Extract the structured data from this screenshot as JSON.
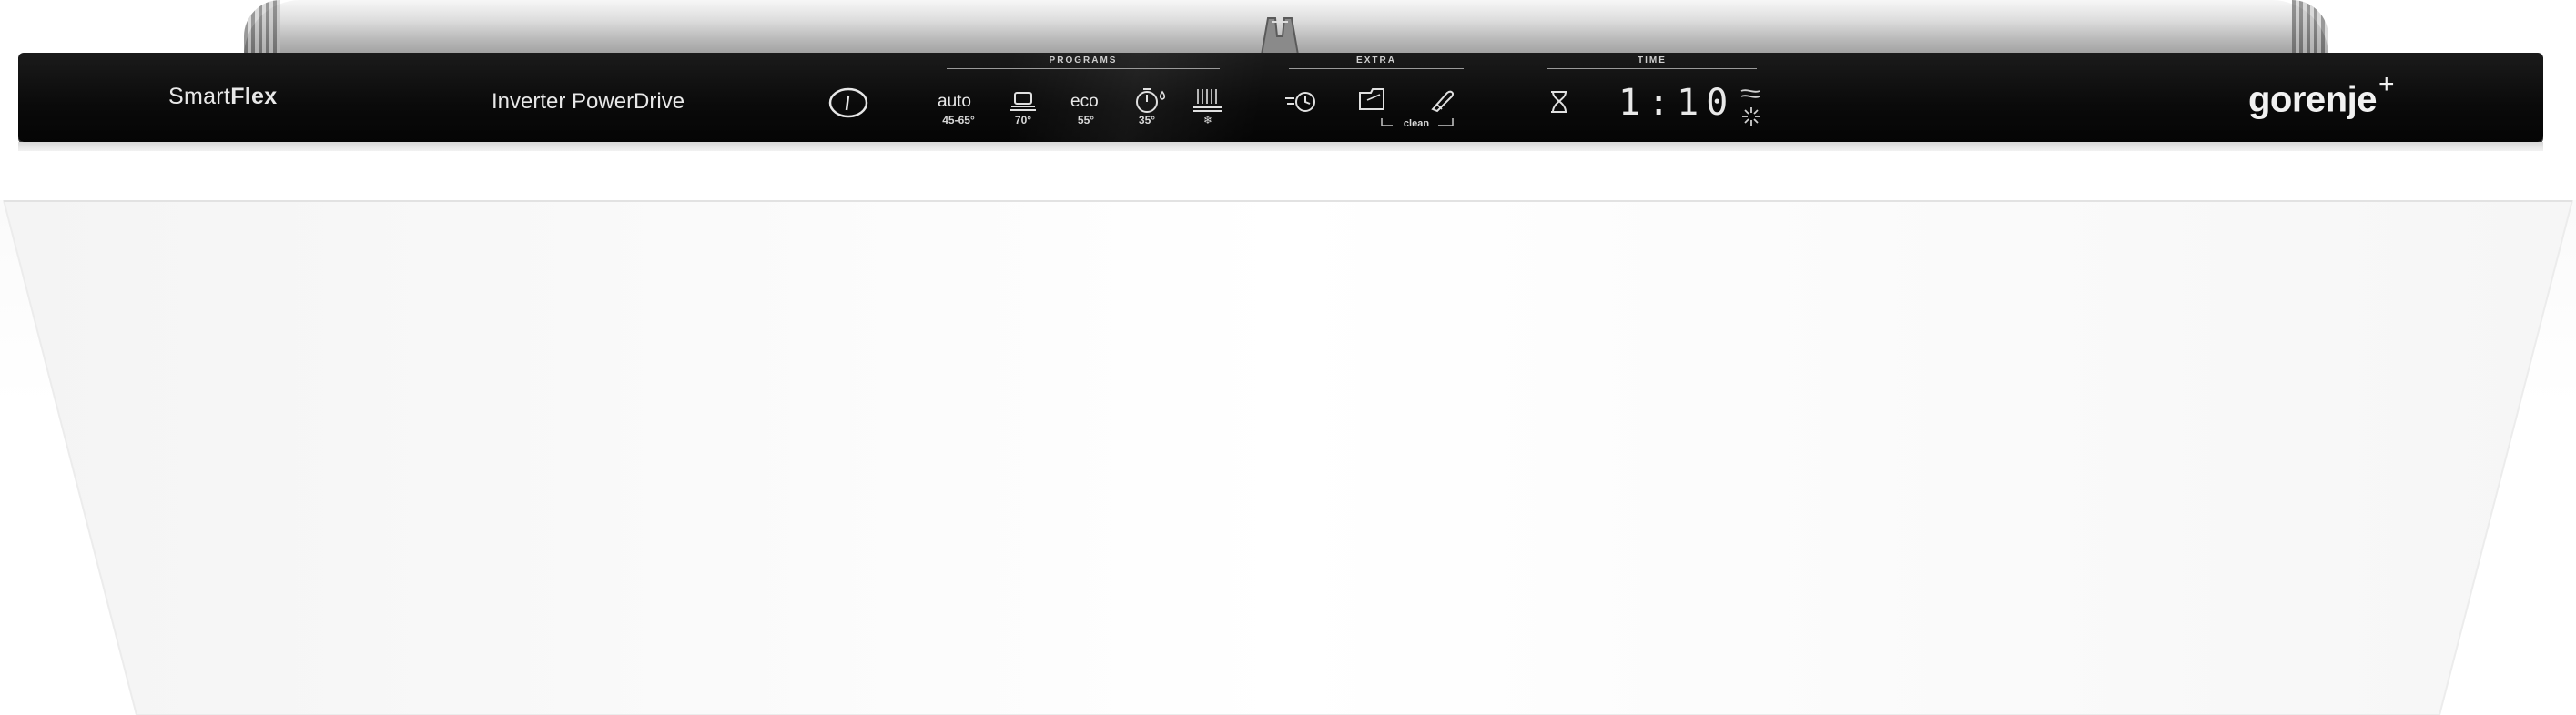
{
  "brand": {
    "series_prefix": "Smart",
    "series_suffix": "Flex",
    "technology": "Inverter PowerDrive",
    "logo": "gorenje",
    "logo_mark": "+"
  },
  "sections": {
    "programs": "PROGRAMS",
    "extra": "EXTRA",
    "time": "TIME"
  },
  "programs": [
    {
      "id": "auto",
      "icon": "auto-text",
      "top": "auto",
      "label": "45-65°"
    },
    {
      "id": "intensive",
      "icon": "pot-icon",
      "label": "70°"
    },
    {
      "id": "eco",
      "icon": "eco-text",
      "top": "eco",
      "label": "55°"
    },
    {
      "id": "quick",
      "icon": "stopwatch-icon",
      "label": "35°"
    },
    {
      "id": "rinse",
      "icon": "rinse-icon",
      "label": "❄"
    }
  ],
  "extras": {
    "clean_label": "clean"
  },
  "display": {
    "time": "1:10"
  },
  "colors": {
    "panel": "#0b0b0b",
    "text": "#e8e8e8",
    "rim": "#b9b9b9",
    "door": "#ffffff"
  }
}
